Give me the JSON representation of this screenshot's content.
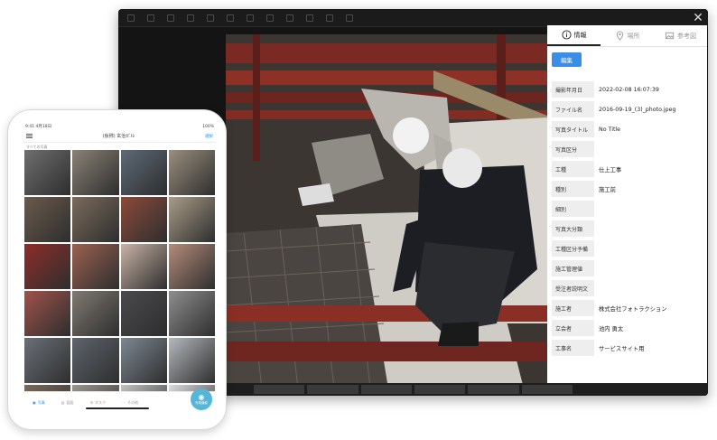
{
  "viewer": {
    "close_label": "✕",
    "tabs": [
      {
        "label": "情報",
        "icon": "info-icon"
      },
      {
        "label": "場所",
        "icon": "map-pin-icon"
      },
      {
        "label": "参考図",
        "icon": "image-icon"
      }
    ],
    "edit_label": "編集",
    "info": [
      {
        "key": "撮影年月日",
        "value": "2022-02-08 16:07:39"
      },
      {
        "key": "ファイル名",
        "value": "2016-09-19_(3)_photo.jpeg"
      },
      {
        "key": "写真タイトル",
        "value": "No Title"
      },
      {
        "key": "写真区分",
        "value": ""
      },
      {
        "key": "工種",
        "value": "仕上工事"
      },
      {
        "key": "種別",
        "value": "施工前"
      },
      {
        "key": "細別",
        "value": ""
      },
      {
        "key": "写真大分類",
        "value": ""
      },
      {
        "key": "工種区分予備",
        "value": ""
      },
      {
        "key": "施工管理値",
        "value": ""
      },
      {
        "key": "受注者説明文",
        "value": ""
      },
      {
        "key": "施工者",
        "value": "株式会社フォトラクション"
      },
      {
        "key": "立会者",
        "value": "池内 勇太"
      },
      {
        "key": "工事名",
        "value": "サービスサイト用"
      }
    ]
  },
  "phone": {
    "time": "9:41 4月18日",
    "battery": "100%",
    "title": "(仮称) 玄治ビル",
    "select_label": "選択",
    "sublabel": "すべての写真",
    "thumb_colors": [
      "#6e6e6e",
      "#8a8276",
      "#5d6a78",
      "#9b8f7e",
      "#6b5a4c",
      "#7b6b5b",
      "#8c4a3a",
      "#a99c88",
      "#8d2d2a",
      "#9c6150",
      "#c9b3a6",
      "#b58b7a",
      "#a0524a",
      "#807a72",
      "#4a4a4e",
      "#8e8e8e",
      "#6a7078",
      "#5e646c",
      "#7d8792",
      "#b4b8bd",
      "#7a6a5a",
      "#9b9590",
      "#c2c2c2",
      "#dcdcdc"
    ],
    "tabbar": [
      {
        "label": "写真",
        "icon": "photo-icon",
        "active": true
      },
      {
        "label": "図面",
        "icon": "document-icon",
        "active": false
      },
      {
        "label": "タスク",
        "icon": "list-icon",
        "active": false
      },
      {
        "label": "その他",
        "icon": "more-icon",
        "active": false
      }
    ],
    "camera_label": "写真撮影"
  }
}
